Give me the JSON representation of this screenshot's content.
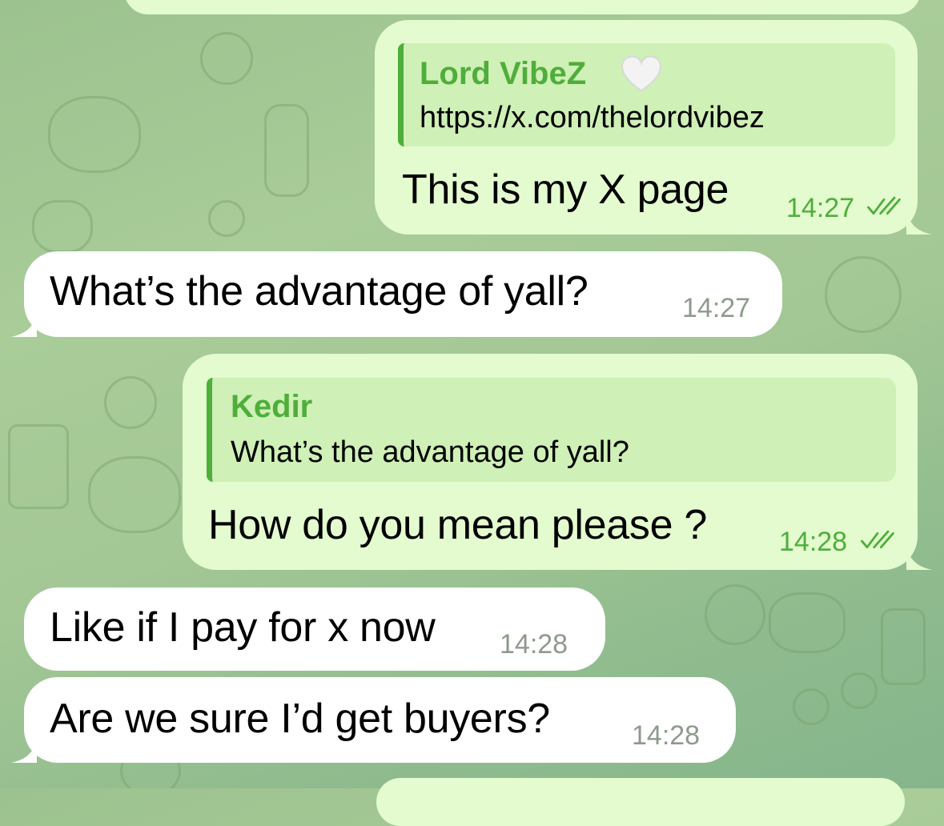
{
  "colors": {
    "outgoing_bubble": "#e3fbcf",
    "incoming_bubble": "#ffffff",
    "accent_green": "#4fae3b",
    "reply_bg": "#cff0b6",
    "incoming_time": "#8e9a8c"
  },
  "messages": [
    {
      "direction": "outgoing",
      "reply": {
        "name": "Lord VibeZ",
        "name_emoji": "white-heart-icon",
        "text": "https://x.com/thelordvibez"
      },
      "text": "This is my X page",
      "time": "14:27",
      "status": "read"
    },
    {
      "direction": "incoming",
      "text": "What’s the advantage of yall?",
      "time": "14:27"
    },
    {
      "direction": "outgoing",
      "reply": {
        "name": "Kedir",
        "text": "What’s the advantage of yall?"
      },
      "text": "How do you mean please ?",
      "time": "14:28",
      "status": "read"
    },
    {
      "direction": "incoming",
      "text": "Like if I pay for x now",
      "time": "14:28"
    },
    {
      "direction": "incoming",
      "text": "Are we sure I’d get buyers?",
      "time": "14:28"
    }
  ]
}
